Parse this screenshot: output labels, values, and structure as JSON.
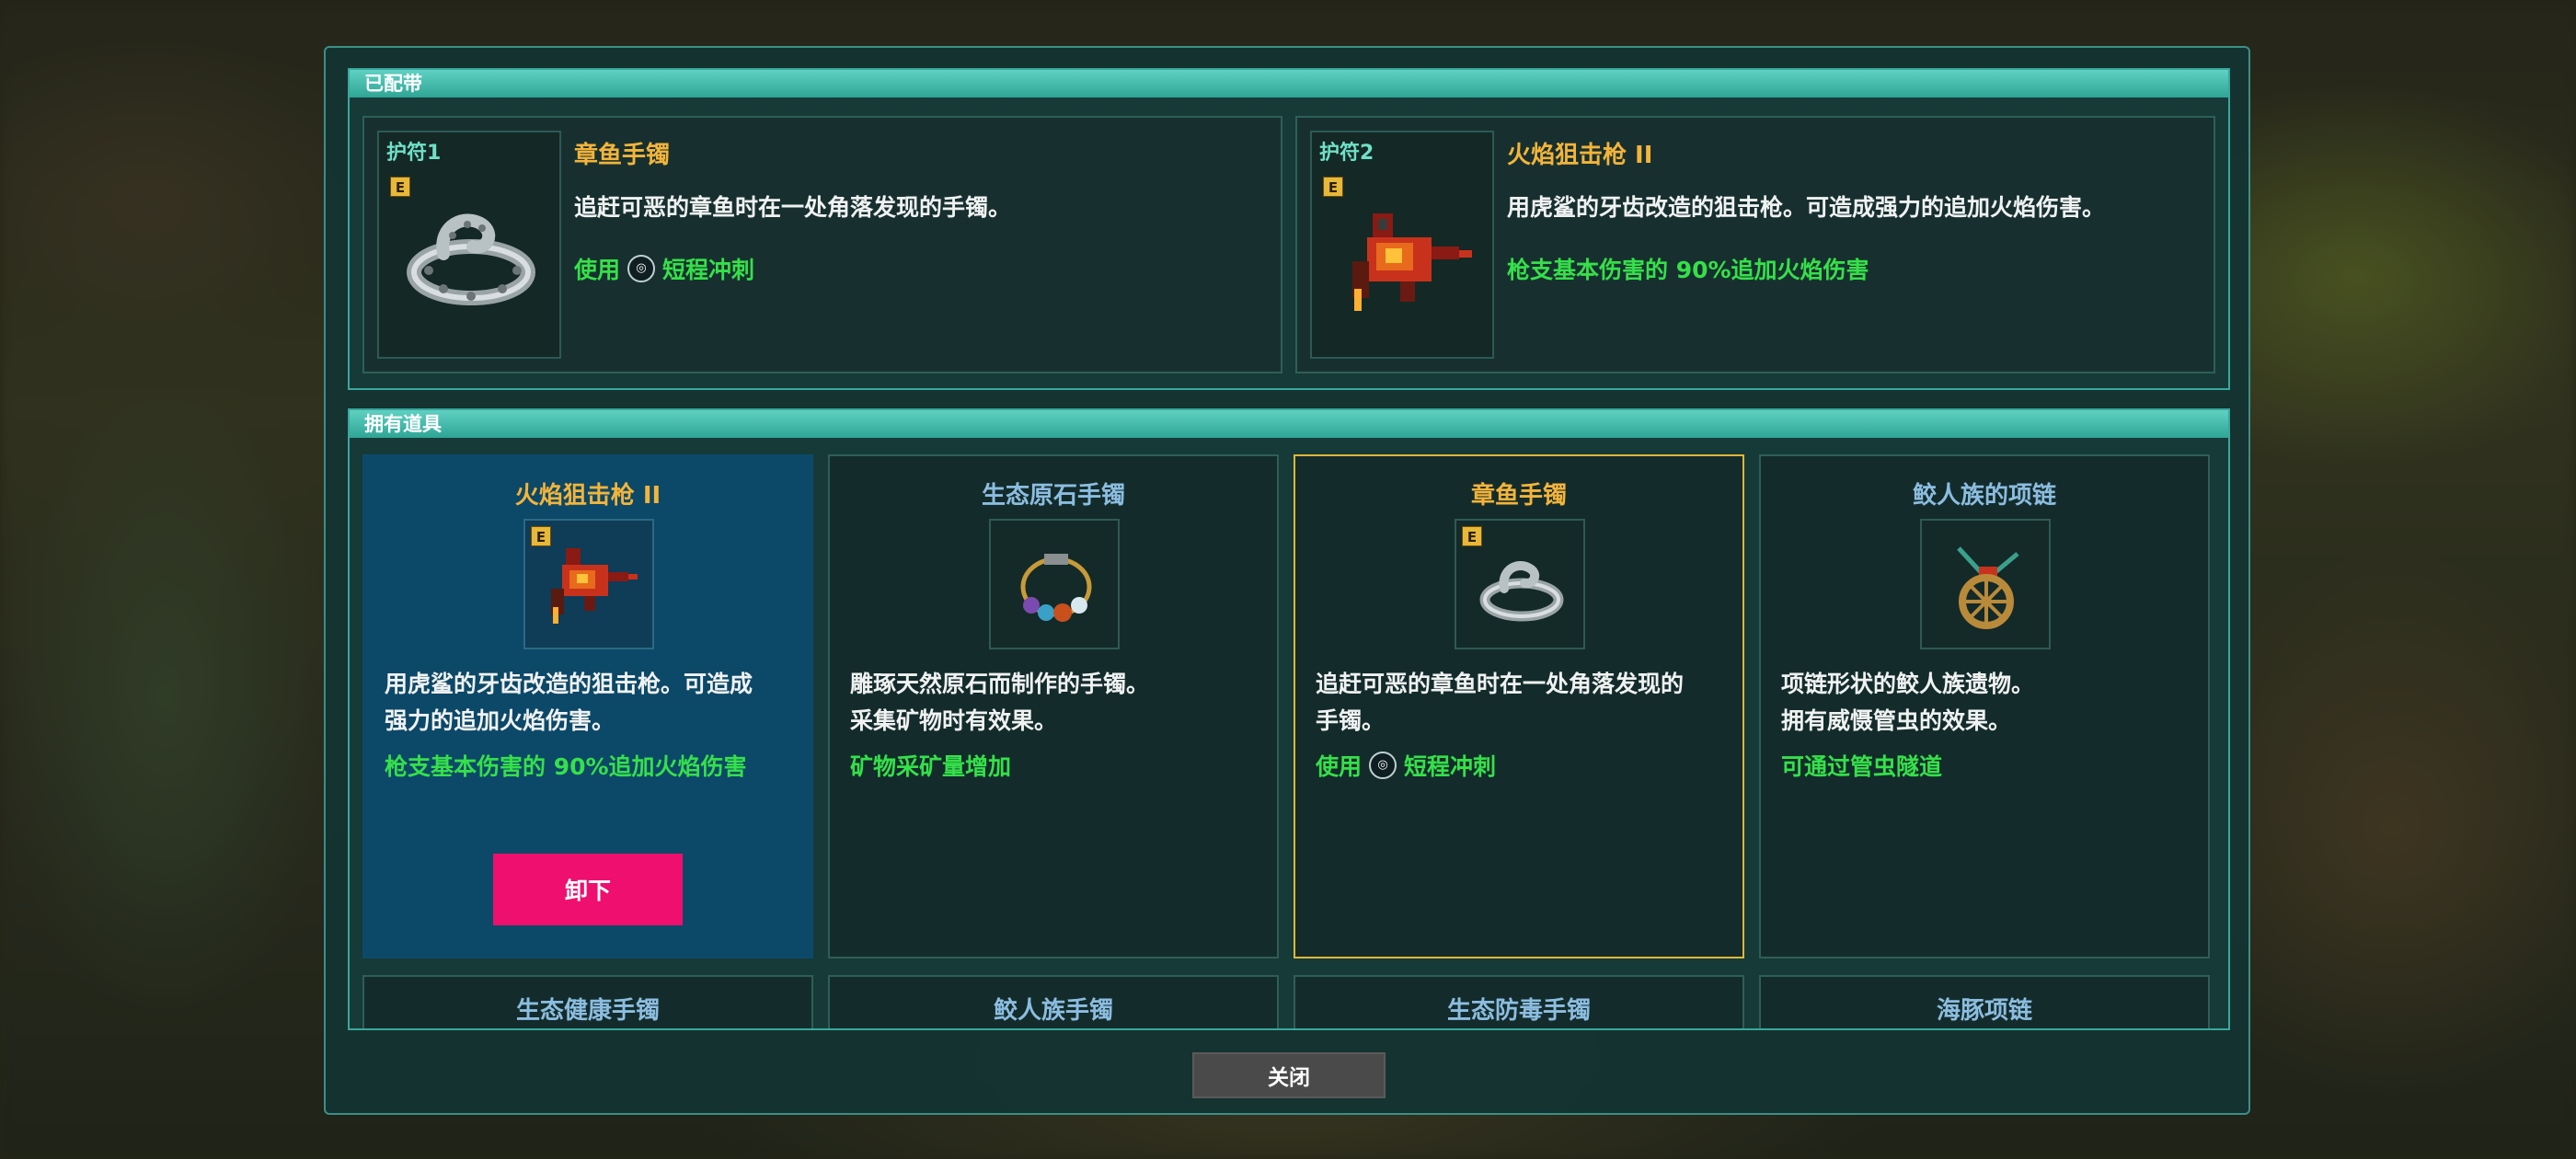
{
  "equipped": {
    "header": "已配带",
    "slots": [
      {
        "label": "护符1",
        "badge": "E",
        "icon": "octopus-bracelet-icon",
        "name": "章鱼手镯",
        "desc": "追赶可恶的章鱼时在一处角落发现的手镯。",
        "effect_prefix": "使用",
        "effect_button_glyph": "◎",
        "effect_suffix": "短程冲刺"
      },
      {
        "label": "护符2",
        "badge": "E",
        "icon": "flame-sniper-icon",
        "name": "火焰狙击枪 II",
        "desc": "用虎鲨的牙齿改造的狙击枪。可造成强力的追加火焰伤害。",
        "effect": "枪支基本伤害的 90%追加火焰伤害"
      }
    ]
  },
  "owned": {
    "header": "拥有道具",
    "cards": [
      {
        "name": "火焰狙击枪 II",
        "badge": "E",
        "icon": "flame-sniper-icon",
        "desc": "用虎鲨的牙齿改造的狙击枪。可造成\n强力的追加火焰伤害。",
        "effect": "枪支基本伤害的 90%追加火焰伤害",
        "button": "卸下"
      },
      {
        "name": "生态原石手镯",
        "icon": "gemstone-bracelet-icon",
        "desc": "雕琢天然原石而制作的手镯。\n采集矿物时有效果。",
        "effect": "矿物采矿量增加"
      },
      {
        "name": "章鱼手镯",
        "badge": "E",
        "icon": "octopus-bracelet-icon",
        "desc": "追赶可恶的章鱼时在一处角落发现的\n手镯。",
        "effect_prefix": "使用",
        "effect_button_glyph": "◎",
        "effect_suffix": "短程冲刺"
      },
      {
        "name": "鲛人族的项链",
        "icon": "merfolk-necklace-icon",
        "desc": "项链形状的鲛人族遗物。\n拥有威慑管虫的效果。",
        "effect": "可通过管虫隧道"
      }
    ],
    "peek_cards": [
      "生态健康手镯",
      "鲛人族手镯",
      "生态防毒手镯",
      "海豚项链"
    ]
  },
  "close_button": "关闭",
  "colors": {
    "accent": "#3aa79d",
    "title_gold": "#f3b43a",
    "effect_green": "#35e04a",
    "selected_bg": "#0c4868",
    "unequip_pink": "#ee0f6e"
  }
}
